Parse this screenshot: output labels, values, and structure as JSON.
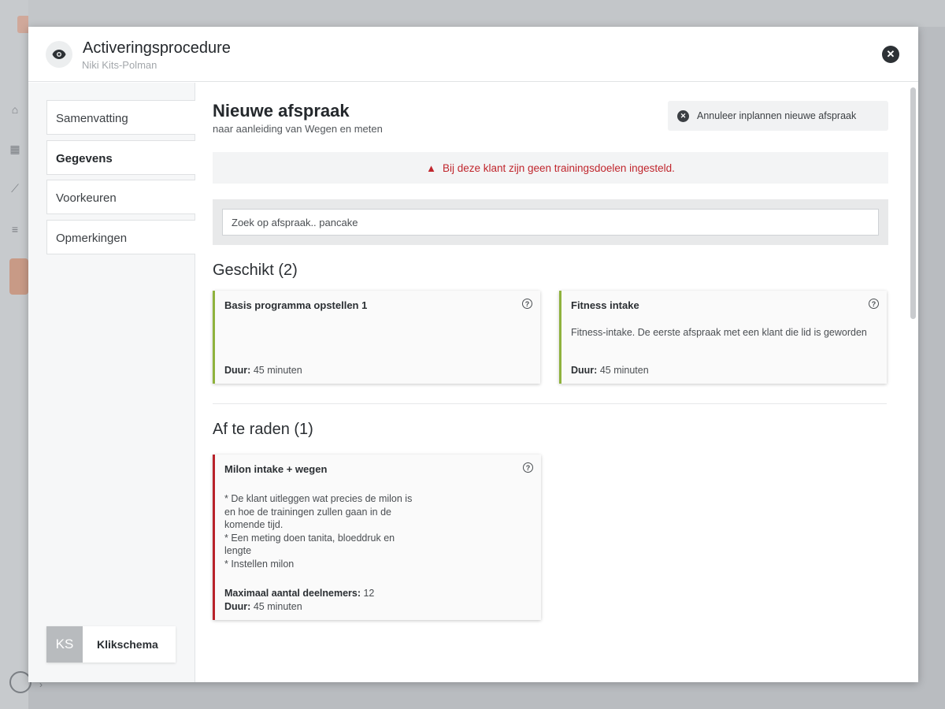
{
  "modal": {
    "title": "Activeringsprocedure",
    "subtitle": "Niki Kits-Polman"
  },
  "nav": {
    "items": [
      {
        "label": "Samenvatting",
        "active": false
      },
      {
        "label": "Gegevens",
        "active": true
      },
      {
        "label": "Voorkeuren",
        "active": false
      },
      {
        "label": "Opmerkingen",
        "active": false
      }
    ],
    "footer": {
      "initials": "KS",
      "label": "Klikschema"
    }
  },
  "content": {
    "title": "Nieuwe afspraak",
    "subtitle": "naar aanleiding van Wegen en meten",
    "cancel_label": "Annuleer inplannen nieuwe afspraak",
    "warning": "Bij deze klant zijn geen trainingsdoelen ingesteld.",
    "search": {
      "placeholder": "Zoek op afspraak.. pancake",
      "value": ""
    },
    "suitable": {
      "title": "Geschikt (2)",
      "cards": [
        {
          "title": "Basis programma opstellen 1",
          "description": "",
          "duration_label": "Duur:",
          "duration": "45 minuten",
          "accent": "#8fb23d"
        },
        {
          "title": "Fitness intake",
          "description": "Fitness-intake. De eerste afspraak met een klant die lid is geworden",
          "duration_label": "Duur:",
          "duration": "45 minuten",
          "accent": "#8fb23d"
        }
      ]
    },
    "discouraged": {
      "title": "Af te raden (1)",
      "cards": [
        {
          "title": "Milon intake + wegen",
          "description": "* De klant uitleggen wat precies de milon is\nen hoe de trainingen zullen gaan in de\nkomende tijd.\n* Een meting doen tanita, bloeddruk en\nlengte\n* Instellen milon",
          "participants_label": "Maximaal aantal deelnemers:",
          "participants": "12",
          "duration_label": "Duur:",
          "duration": "45 minuten",
          "accent": "#b8222a"
        }
      ]
    }
  },
  "icons": {
    "eye": "eye-icon",
    "close": "close-icon",
    "warning": "warning-icon",
    "help": "help-icon"
  }
}
